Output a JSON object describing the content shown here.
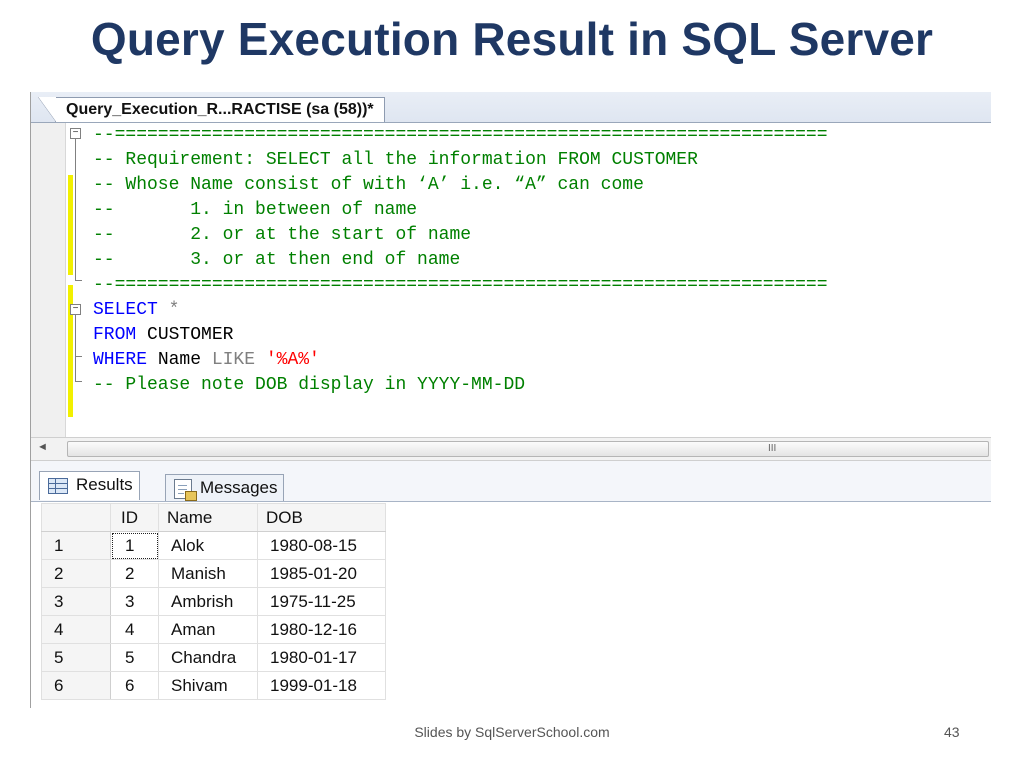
{
  "slide": {
    "title": "Query Execution Result in SQL Server",
    "footer": "Slides by SqlServerSchool.com",
    "page_number": "43"
  },
  "editor": {
    "tab_title": "Query_Execution_R...RACTISE (sa (58))*",
    "lines": {
      "sep1": "--==================================================================",
      "req": "-- Requirement: SELECT all the information FROM CUSTOMER",
      "whose": "-- Whose Name consist of with ‘A’ i.e. “A” can come",
      "item1": "--       1. in between of name",
      "item2": "--       2. or at the start of name",
      "item3": "--       3. or at then end of name",
      "sep2": "--==================================================================",
      "select_kw": "SELECT",
      "select_star": " *",
      "from_kw": "FROM",
      "from_table": " CUSTOMER",
      "where_kw": "WHERE",
      "where_col": " Name ",
      "like_kw": "LIKE",
      "like_val": " '%A%'",
      "note": "-- Please note DOB display in YYYY-MM-DD"
    },
    "scroll_grip": "III",
    "left_arrow": "◄"
  },
  "results": {
    "tabs": {
      "results": "Results",
      "messages": "Messages"
    },
    "columns": [
      "ID",
      "Name",
      "DOB"
    ],
    "rows": [
      {
        "num": "1",
        "id": "1",
        "name": "Alok",
        "dob": "1980-08-15"
      },
      {
        "num": "2",
        "id": "2",
        "name": "Manish",
        "dob": "1985-01-20"
      },
      {
        "num": "3",
        "id": "3",
        "name": "Ambrish",
        "dob": "1975-11-25"
      },
      {
        "num": "4",
        "id": "4",
        "name": "Aman",
        "dob": "1980-12-16"
      },
      {
        "num": "5",
        "id": "5",
        "name": "Chandra",
        "dob": "1980-01-17"
      },
      {
        "num": "6",
        "id": "6",
        "name": "Shivam",
        "dob": "1999-01-18"
      }
    ]
  },
  "colors": {
    "title": "#1f3864",
    "comment": "#008000",
    "keyword": "#0000ff",
    "string": "#ff0000",
    "change_bar": "#f2f000"
  }
}
